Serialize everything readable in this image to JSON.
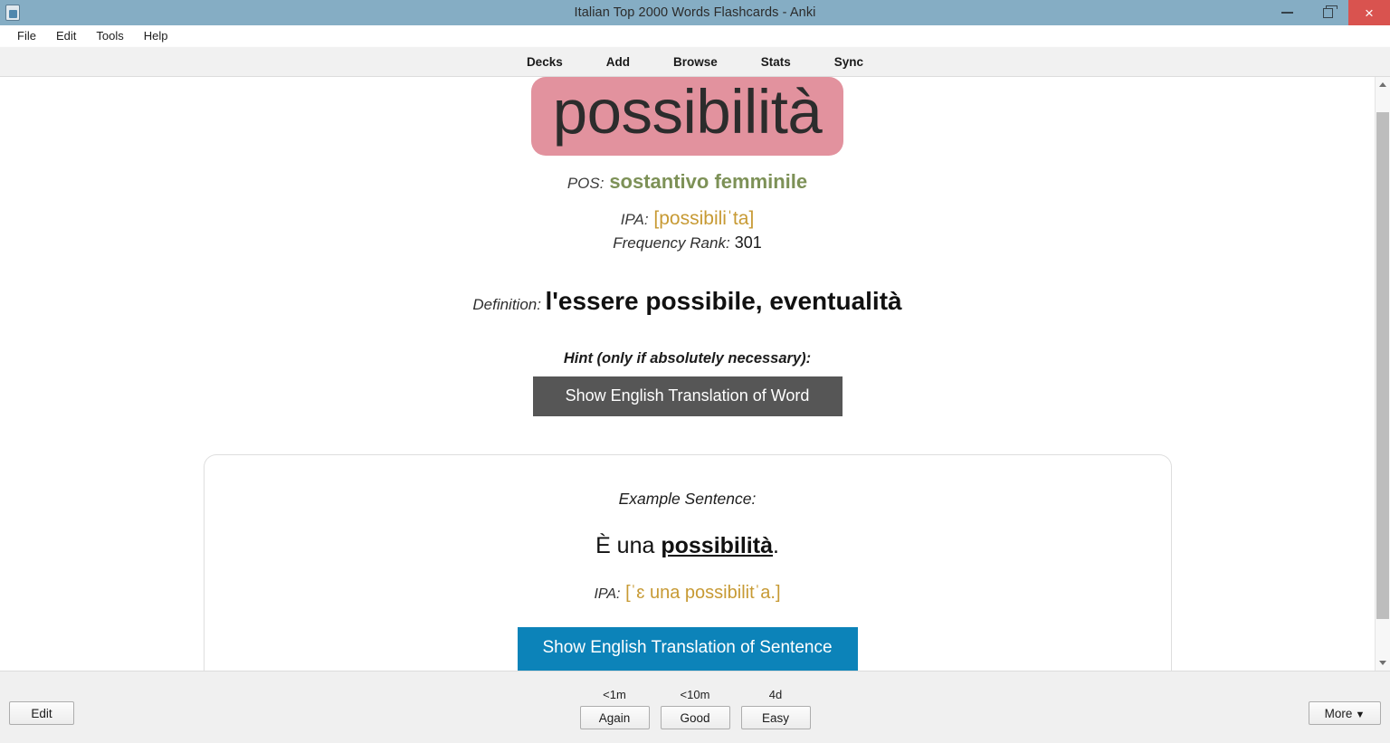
{
  "window": {
    "title": "Italian Top 2000 Words Flashcards - Anki",
    "icon": "anki-app-icon",
    "controls": {
      "minimize": "minimize-icon",
      "maximize": "restore-icon",
      "close": "×"
    },
    "titlebar_color": "#85adc4",
    "close_color": "#d9534f"
  },
  "menu": {
    "items": [
      {
        "label": "File"
      },
      {
        "label": "Edit"
      },
      {
        "label": "Tools"
      },
      {
        "label": "Help"
      }
    ]
  },
  "toolbar": {
    "links": [
      {
        "label": "Decks"
      },
      {
        "label": "Add"
      },
      {
        "label": "Browse"
      },
      {
        "label": "Stats"
      },
      {
        "label": "Sync"
      }
    ]
  },
  "card": {
    "headword": "possibilità",
    "headword_highlight_color": "#e2929e",
    "pos_label": "POS:",
    "pos_value": "sostantivo femminile",
    "pos_color": "#7d9157",
    "ipa_label": "IPA:",
    "ipa_value": "[possibiliˈta]",
    "ipa_color": "#c79a34",
    "frequency_label": "Frequency Rank:",
    "frequency_value": "301",
    "definition_label": "Definition:",
    "definition_value": "l'essere possibile, eventualità",
    "hint_label": "Hint (only if absolutely necessary):",
    "hint_button": "Show English Translation of Word",
    "hint_button_color": "#565656",
    "example": {
      "label": "Example Sentence:",
      "sentence_prefix": "È una ",
      "sentence_keyword": "possibilità",
      "sentence_suffix": ".",
      "ipa_label": "IPA:",
      "ipa_value": "[ˈɛ una possibilitˈa.]",
      "button": "Show English Translation of Sentence",
      "button_color": "#0c83b9"
    }
  },
  "bottom_bar": {
    "edit_label": "Edit",
    "more_label": "More",
    "more_caret": "▼",
    "answers": [
      {
        "interval": "<1m",
        "label": "Again"
      },
      {
        "interval": "<10m",
        "label": "Good"
      },
      {
        "interval": "4d",
        "label": "Easy"
      }
    ]
  }
}
